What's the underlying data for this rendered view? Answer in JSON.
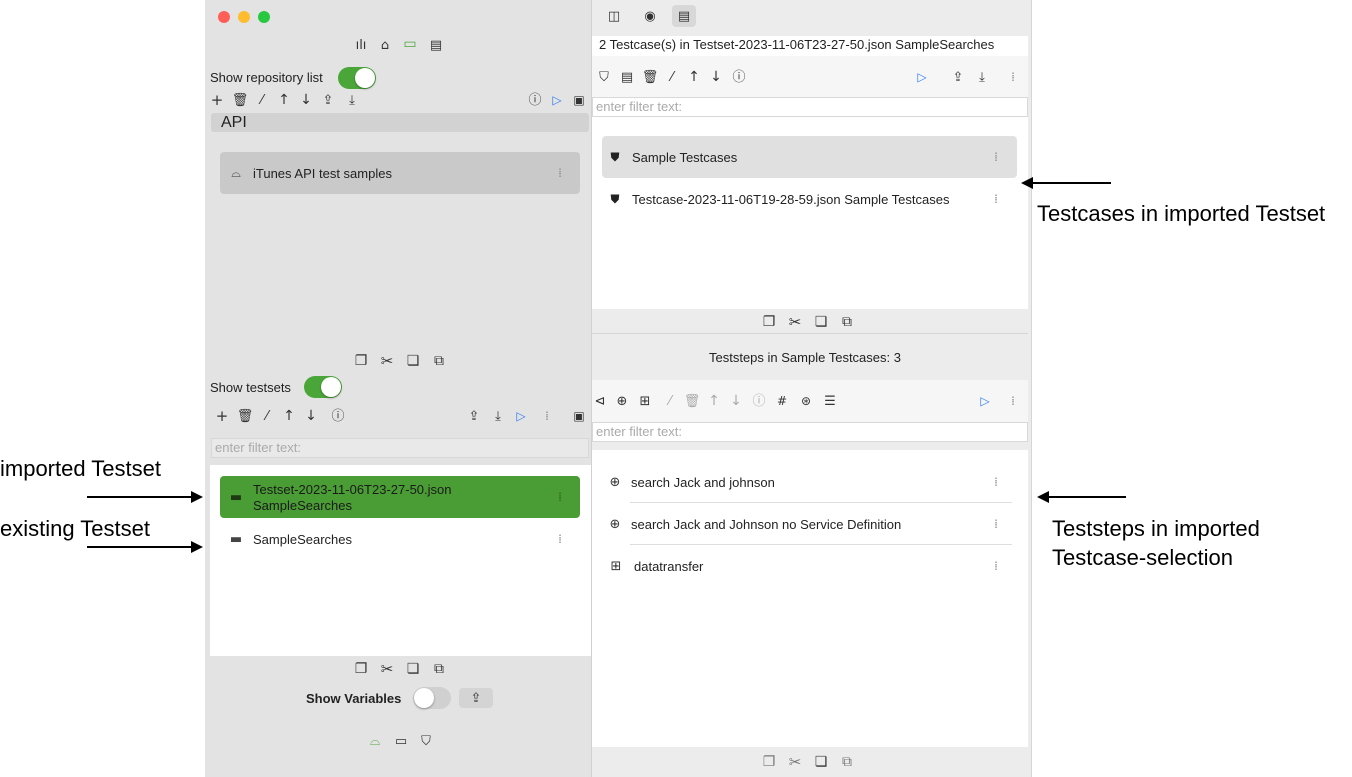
{
  "colors": {
    "toggle_on": "#4ba63a",
    "selected_testset": "#4a9d34",
    "play_blue": "#2f7bf5",
    "traffic_red": "#ff5f57",
    "traffic_yellow": "#febc2e",
    "traffic_green": "#28c840"
  },
  "left": {
    "repo_toggle_label": "Show repository list",
    "section_header": "API",
    "repositories": [
      {
        "label": "iTunes API test samples"
      }
    ],
    "testsets_toggle_label": "Show testsets",
    "testset_filter_placeholder": "enter filter text:",
    "testsets": [
      {
        "label": "Testset-2023-11-06T23-27-50.json SampleSearches",
        "selected": true
      },
      {
        "label": "SampleSearches",
        "selected": false
      }
    ],
    "variables_label": "Show Variables"
  },
  "right": {
    "testcases_header": "2 Testcase(s) in Testset-2023-11-06T23-27-50.json SampleSearches",
    "testcase_filter_placeholder": "enter filter text:",
    "testcases": [
      {
        "label": "Sample Testcases",
        "selected": true
      },
      {
        "label": "Testcase-2023-11-06T19-28-59.json Sample Testcases",
        "selected": false
      }
    ],
    "teststeps_header": "Teststeps in Sample Testcases: 3",
    "teststep_filter_placeholder": "enter filter text:",
    "teststeps": [
      {
        "label": "search Jack and johnson",
        "icon": "globe-icon"
      },
      {
        "label": "search Jack and Johnson no Service Definition",
        "icon": "globe-icon"
      },
      {
        "label": "datatransfer",
        "icon": "transfer-icon"
      }
    ]
  },
  "annotations": {
    "imported_testset": "imported Testset",
    "existing_testset": "existing Testset",
    "testcases_in_imported": "Testcases in imported Testset",
    "teststeps_line1": "Teststeps in imported",
    "teststeps_line2": "Testcase-selection"
  }
}
